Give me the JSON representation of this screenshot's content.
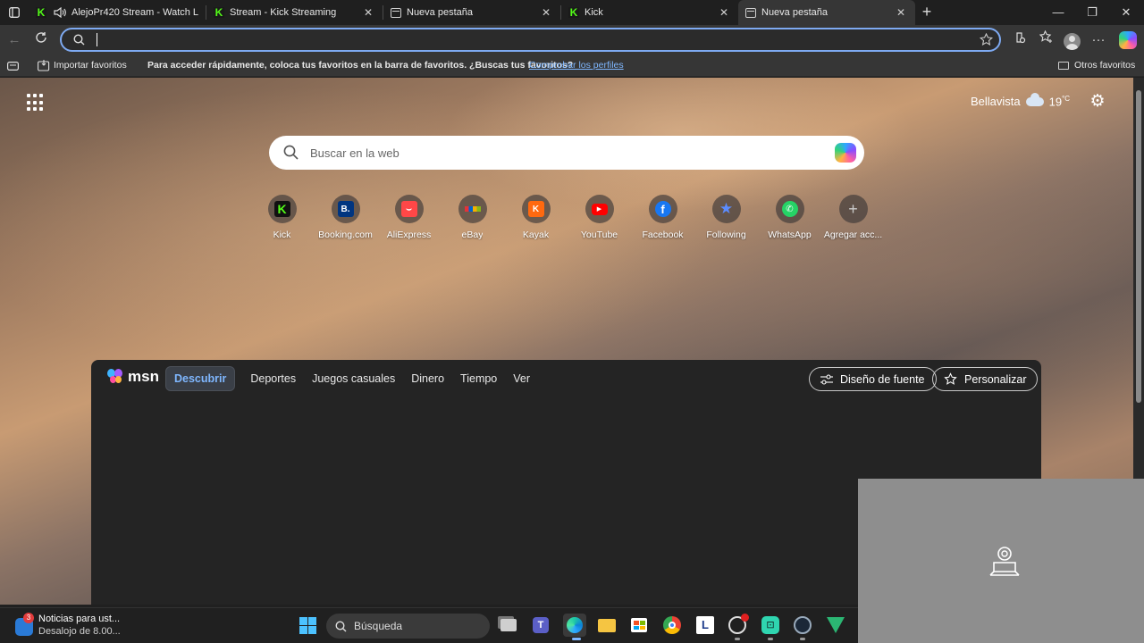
{
  "tabs": [
    {
      "title": "AlejoPr420 Stream - Watch L",
      "icon": "kick-icon",
      "audio": true
    },
    {
      "title": "Stream - Kick Streaming",
      "icon": "kick-icon"
    },
    {
      "title": "Nueva pestaña",
      "icon": "newtab-icon"
    },
    {
      "title": "Kick",
      "icon": "kick-icon"
    },
    {
      "title": "Nueva pestaña",
      "icon": "newtab-icon",
      "active": true
    }
  ],
  "address": {
    "value": "",
    "placeholder": ""
  },
  "favbar": {
    "import": "Importar favoritos",
    "message": "Para acceder rápidamente, coloca tus favoritos en la barra de favoritos. ¿Buscas tus favoritos?",
    "link": "Comprobar los perfiles",
    "other": "Otros favoritos"
  },
  "weather": {
    "location": "Bellavista",
    "temp": "19",
    "unit": "°C"
  },
  "search": {
    "placeholder": "Buscar en la web"
  },
  "quicklinks": [
    {
      "label": "Kick",
      "color": "#53fc18"
    },
    {
      "label": "Booking.com",
      "color": "#003580"
    },
    {
      "label": "AliExpress",
      "color": "#ff4747"
    },
    {
      "label": "eBay",
      "color": "#e53238"
    },
    {
      "label": "Kayak",
      "color": "#ff690f"
    },
    {
      "label": "YouTube",
      "color": "#ff0000"
    },
    {
      "label": "Facebook",
      "color": "#1877f2"
    },
    {
      "label": "Following",
      "color": "#3b82f6"
    },
    {
      "label": "WhatsApp",
      "color": "#25d366"
    },
    {
      "label": "Agregar acc..."
    }
  ],
  "msn": {
    "brand": "msn",
    "nav": [
      "Descubrir",
      "Deportes",
      "Juegos casuales",
      "Dinero",
      "Tiempo",
      "Ver"
    ],
    "font_button": "Diseño de fuente",
    "customize_button": "Personalizar"
  },
  "taskbar": {
    "news_title": "Noticias para ust...",
    "news_sub": "Desalojo de 8.00...",
    "news_badge": "3",
    "search_label": "Búsqueda"
  }
}
